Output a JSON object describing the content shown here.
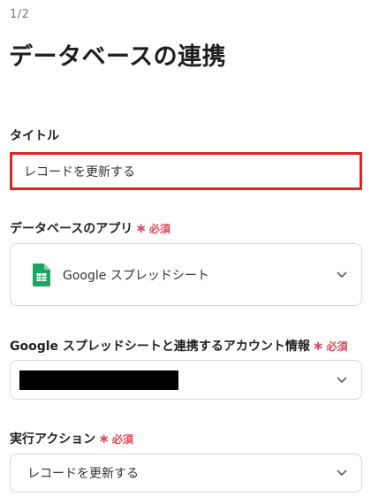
{
  "header": {
    "step": "1/2",
    "title": "データベースの連携"
  },
  "title_field": {
    "label": "タイトル",
    "value": "レコードを更新する"
  },
  "database_app": {
    "label": "データベースのアプリ",
    "required_label": "必須",
    "selected": "Google スプレッドシート",
    "icon": "google-sheets-icon"
  },
  "account": {
    "label": "Google スプレッドシートと連携するアカウント情報",
    "required_label": "必須"
  },
  "action": {
    "label": "実行アクション",
    "required_label": "必須",
    "selected": "レコードを更新する"
  },
  "colors": {
    "required": "#e2465a",
    "highlight_border": "#e02424",
    "sheets_green": "#1fa463"
  }
}
